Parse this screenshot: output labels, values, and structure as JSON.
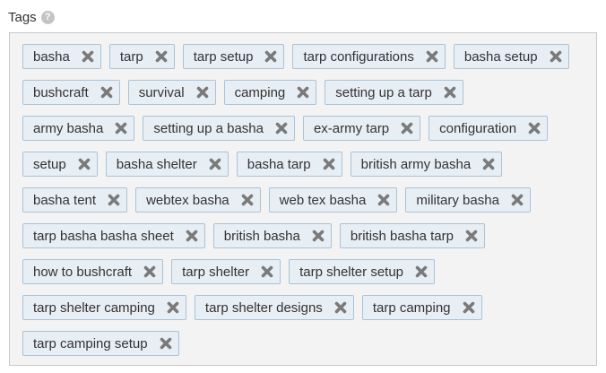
{
  "field": {
    "label": "Tags",
    "help_icon_glyph": "?"
  },
  "tags": [
    "basha",
    "tarp",
    "tarp setup",
    "tarp configurations",
    "basha setup",
    "bushcraft",
    "survival",
    "camping",
    "setting up a tarp",
    "army basha",
    "setting up a basha",
    "ex-army tarp",
    "configuration",
    "setup",
    "basha shelter",
    "basha tarp",
    "british army basha",
    "basha tent",
    "webtex basha",
    "web tex basha",
    "military basha",
    "tarp basha basha sheet",
    "british basha",
    "british basha tarp",
    "how to bushcraft",
    "tarp shelter",
    "tarp shelter setup",
    "tarp shelter camping",
    "tarp shelter designs",
    "tarp camping",
    "tarp camping setup"
  ],
  "colors": {
    "tag_background": "#e7eef4",
    "tag_border": "#a9c3d7",
    "remove_icon": "#7a7a7a",
    "box_background": "#f3f3f3",
    "help_icon": "#c4c4c4"
  },
  "icons": {
    "remove": "close-icon",
    "help": "help-icon"
  }
}
